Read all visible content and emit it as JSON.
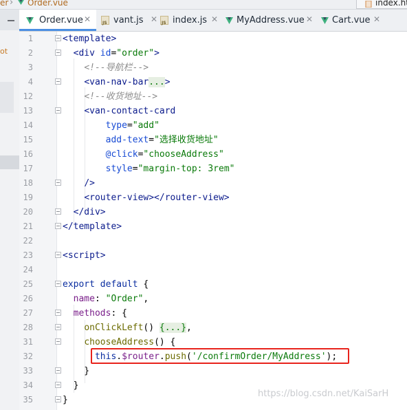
{
  "breadcrumbs": {
    "first": "er",
    "second": "Order.vue"
  },
  "right_tab": {
    "label": "index.ht"
  },
  "sidebar": {
    "text": "ot"
  },
  "tabs": [
    {
      "label": "Order.vue",
      "icon": "vue-icon",
      "active": true,
      "close": "✕"
    },
    {
      "label": "vant.js",
      "icon": "js-icon",
      "active": false,
      "close": "✕"
    },
    {
      "label": "index.js",
      "icon": "js-icon",
      "active": false,
      "close": "✕"
    },
    {
      "label": "MyAddress.vue",
      "icon": "vue-icon",
      "active": false,
      "close": "✕"
    },
    {
      "label": "Cart.vue",
      "icon": "vue-icon",
      "active": false,
      "close": "✕"
    }
  ],
  "colors": {
    "accent": "#4b8fe3",
    "highlight": "#e8221b",
    "vue": "#3fb27f"
  },
  "editor": {
    "lines": [
      {
        "n": "1",
        "tokens": [
          [
            "tag",
            "<template>"
          ]
        ]
      },
      {
        "n": "2",
        "tokens": [
          [
            "plain",
            "  "
          ],
          [
            "tag",
            "<div "
          ],
          [
            "attr",
            "id"
          ],
          [
            "plain",
            "="
          ],
          [
            "str",
            "\"order\""
          ],
          [
            "tag",
            ">"
          ]
        ]
      },
      {
        "n": "3",
        "tokens": [
          [
            "plain",
            "    "
          ],
          [
            "cmt",
            "<!--导航栏-->"
          ]
        ]
      },
      {
        "n": "4",
        "tokens": [
          [
            "plain",
            "    "
          ],
          [
            "tag",
            "<van-nav-bar"
          ],
          [
            "fold-text",
            "..."
          ],
          [
            "tag",
            ">"
          ]
        ]
      },
      {
        "n": "12",
        "tokens": [
          [
            "plain",
            "    "
          ],
          [
            "cmt",
            "<!--收货地址-->"
          ]
        ]
      },
      {
        "n": "13",
        "tokens": [
          [
            "plain",
            "    "
          ],
          [
            "tag",
            "<van-contact-card"
          ]
        ]
      },
      {
        "n": "14",
        "tokens": [
          [
            "plain",
            "        "
          ],
          [
            "attr",
            "type"
          ],
          [
            "plain",
            "="
          ],
          [
            "str",
            "\"add\""
          ]
        ]
      },
      {
        "n": "15",
        "tokens": [
          [
            "plain",
            "        "
          ],
          [
            "attr",
            "add-text"
          ],
          [
            "plain",
            "="
          ],
          [
            "str",
            "\"选择收货地址\""
          ]
        ]
      },
      {
        "n": "16",
        "tokens": [
          [
            "plain",
            "        "
          ],
          [
            "attr",
            "@click"
          ],
          [
            "plain",
            "="
          ],
          [
            "str",
            "\"chooseAddress\""
          ]
        ]
      },
      {
        "n": "17",
        "tokens": [
          [
            "plain",
            "        "
          ],
          [
            "attr",
            "style"
          ],
          [
            "plain",
            "="
          ],
          [
            "str",
            "\"margin-top: 3rem\""
          ]
        ]
      },
      {
        "n": "18",
        "tokens": [
          [
            "plain",
            "    "
          ],
          [
            "tag",
            "/>"
          ]
        ]
      },
      {
        "n": "19",
        "tokens": [
          [
            "plain",
            "    "
          ],
          [
            "tag",
            "<router-view></router-view>"
          ]
        ]
      },
      {
        "n": "20",
        "tokens": [
          [
            "plain",
            "  "
          ],
          [
            "tag",
            "</div>"
          ]
        ]
      },
      {
        "n": "21",
        "tokens": [
          [
            "tag",
            "</template>"
          ]
        ]
      },
      {
        "n": "22",
        "tokens": []
      },
      {
        "n": "23",
        "tokens": [
          [
            "tag",
            "<script>"
          ]
        ]
      },
      {
        "n": "24",
        "tokens": []
      },
      {
        "n": "25",
        "tokens": [
          [
            "kw",
            "export default "
          ],
          [
            "plain",
            "{"
          ]
        ]
      },
      {
        "n": "26",
        "tokens": [
          [
            "plain",
            "  "
          ],
          [
            "prop",
            "name"
          ],
          [
            "plain",
            ": "
          ],
          [
            "str",
            "\"Order\""
          ],
          [
            "plain",
            ","
          ]
        ]
      },
      {
        "n": "27",
        "tokens": [
          [
            "plain",
            "  "
          ],
          [
            "prop",
            "methods"
          ],
          [
            "plain",
            ": {"
          ]
        ]
      },
      {
        "n": "28",
        "tokens": [
          [
            "plain",
            "    "
          ],
          [
            "fn",
            "onClickLeft"
          ],
          [
            "plain",
            "() "
          ],
          [
            "fold-text",
            "{...}"
          ],
          [
            "plain",
            ","
          ]
        ]
      },
      {
        "n": "31",
        "tokens": [
          [
            "plain",
            "    "
          ],
          [
            "fn",
            "chooseAddress"
          ],
          [
            "plain",
            "() {"
          ]
        ]
      },
      {
        "n": "32",
        "tokens": [
          [
            "plain",
            "      "
          ],
          [
            "kw",
            "this"
          ],
          [
            "plain",
            "."
          ],
          [
            "prop",
            "$router"
          ],
          [
            "plain",
            "."
          ],
          [
            "fn",
            "push"
          ],
          [
            "plain",
            "("
          ],
          [
            "str",
            "'/confirmOrder/MyAddress'"
          ],
          [
            "plain",
            ");"
          ]
        ]
      },
      {
        "n": "33",
        "tokens": [
          [
            "plain",
            "    }"
          ]
        ]
      },
      {
        "n": "34",
        "tokens": [
          [
            "plain",
            "  }"
          ]
        ]
      },
      {
        "n": "35",
        "tokens": [
          [
            "plain",
            "}"
          ]
        ]
      }
    ]
  },
  "watermark": "https://blog.csdn.net/KaiSarH"
}
